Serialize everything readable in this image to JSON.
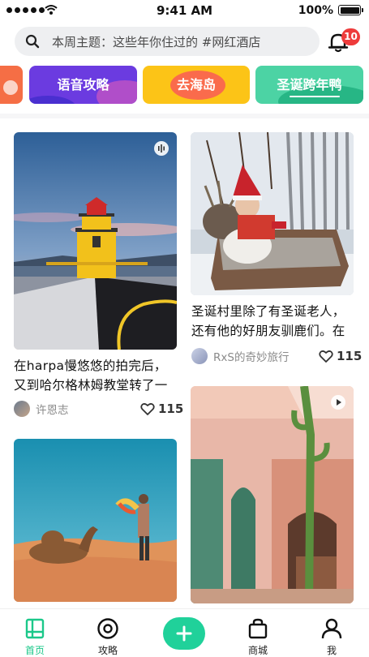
{
  "status_bar": {
    "time": "9:41 AM",
    "battery": "100%"
  },
  "search": {
    "placeholder": "本周主题：这些年你住过的 #网红酒店"
  },
  "notifications": {
    "count": "10"
  },
  "categories": [
    "",
    "语音攻略",
    "去海岛",
    "圣诞跨年鸭"
  ],
  "feed": [
    {
      "title": "在harpa慢悠悠的拍完后，又到哈尔格林姆教堂转了一",
      "author": "许恩志",
      "likes": "115",
      "badge": "audio"
    },
    {
      "title": "圣诞村里除了有圣诞老人，还有他的好朋友驯鹿们。在",
      "author": "RxS的奇妙旅行",
      "likes": "115",
      "badge": ""
    },
    {
      "title": "",
      "author": "",
      "likes": "",
      "badge": ""
    },
    {
      "title": "",
      "author": "",
      "likes": "",
      "badge": "video"
    }
  ],
  "tabbar": {
    "home": "首页",
    "guide": "攻略",
    "add": "+",
    "mall": "商城",
    "me": "我"
  },
  "colors": {
    "accent": "#1cc88a",
    "badge": "#ee3b3b"
  }
}
